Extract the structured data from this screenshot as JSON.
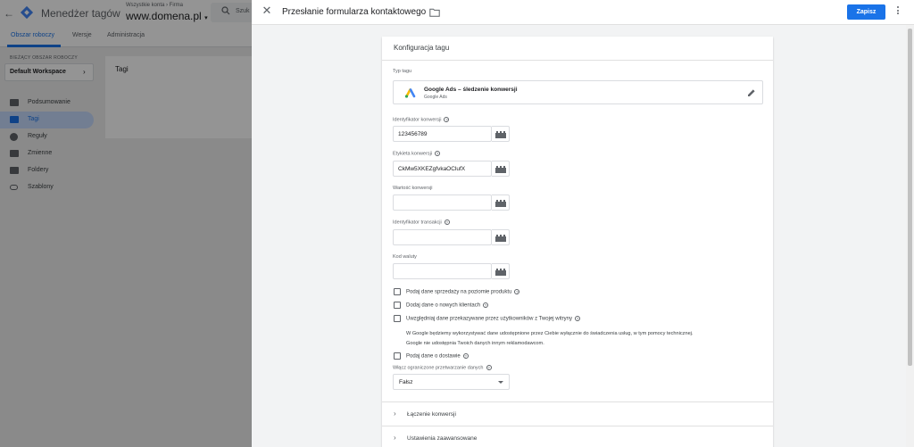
{
  "gtm": {
    "app_title": "Menedżer tagów",
    "accounts_label": "Wszystkie konta › Firma",
    "domain": "www.domena.pl",
    "search_placeholder": "Szuk",
    "tabs": [
      {
        "label": "Obszar roboczy",
        "active": true
      },
      {
        "label": "Wersje",
        "active": false
      },
      {
        "label": "Administracja",
        "active": false
      }
    ],
    "workspace_label": "BIEŻĄCY OBSZAR ROBOCZY",
    "workspace_name": "Default Workspace",
    "nav": [
      {
        "label": "Podsumowanie",
        "icon": "briefcase-icon",
        "active": false
      },
      {
        "label": "Tagi",
        "icon": "tag-icon",
        "active": true
      },
      {
        "label": "Reguły",
        "icon": "trigger-icon",
        "active": false
      },
      {
        "label": "Zmienne",
        "icon": "variables-icon",
        "active": false
      },
      {
        "label": "Foldery",
        "icon": "folder-icon",
        "active": false
      },
      {
        "label": "Szablony",
        "icon": "template-icon",
        "active": false
      }
    ],
    "content_card_title": "Tagi"
  },
  "sheet": {
    "title": "Przesłanie formularza kontaktowego",
    "save_label": "Zapisz"
  },
  "card": {
    "title": "Konfiguracja tagu",
    "tag_type_label": "Typ tagu",
    "tag_type_name": "Google Ads – śledzenie konwersji",
    "tag_type_vendor": "Google Ads",
    "fields": [
      {
        "label": "Identyfikator konwersji",
        "value": "123456789",
        "help": true
      },
      {
        "label": "Etykieta konwersji",
        "value": "CkMw5XKEZgfvkaOClufX",
        "help": true
      },
      {
        "label": "Wartość konwersji",
        "value": "",
        "help": false
      },
      {
        "label": "Identyfikator transakcji",
        "value": "",
        "help": true
      },
      {
        "label": "Kod waluty",
        "value": "",
        "help": false
      }
    ],
    "checkboxes": [
      {
        "label": "Podaj dane sprzedaży na poziomie produktu",
        "checked": false
      },
      {
        "label": "Dodaj dane o nowych klientach",
        "checked": false
      },
      {
        "label": "Uwzględniaj dane przekazywane przez użytkowników z Twojej witryny",
        "checked": false
      },
      {
        "label": "Podaj dane o dostawie",
        "checked": false
      }
    ],
    "notice_line1": "W Google będziemy wykorzystywać dane udostępnione przez Ciebie wyłącznie do świadczenia usług, w tym pomocy technicznej.",
    "notice_line2": "Google nie udostępnia Twoich danych innym reklamodawcom.",
    "restricted_label": "Włącz ograniczone przetwarzanie danych",
    "restricted_value": "Fałsz",
    "sections": [
      {
        "label": "Łączenie konwersji"
      },
      {
        "label": "Ustawienia zaawansowane"
      }
    ]
  },
  "colors": {
    "accent": "#1a73e8",
    "ads_yellow": "#fbbc04",
    "ads_blue": "#4285f4",
    "ads_green": "#34a853"
  }
}
